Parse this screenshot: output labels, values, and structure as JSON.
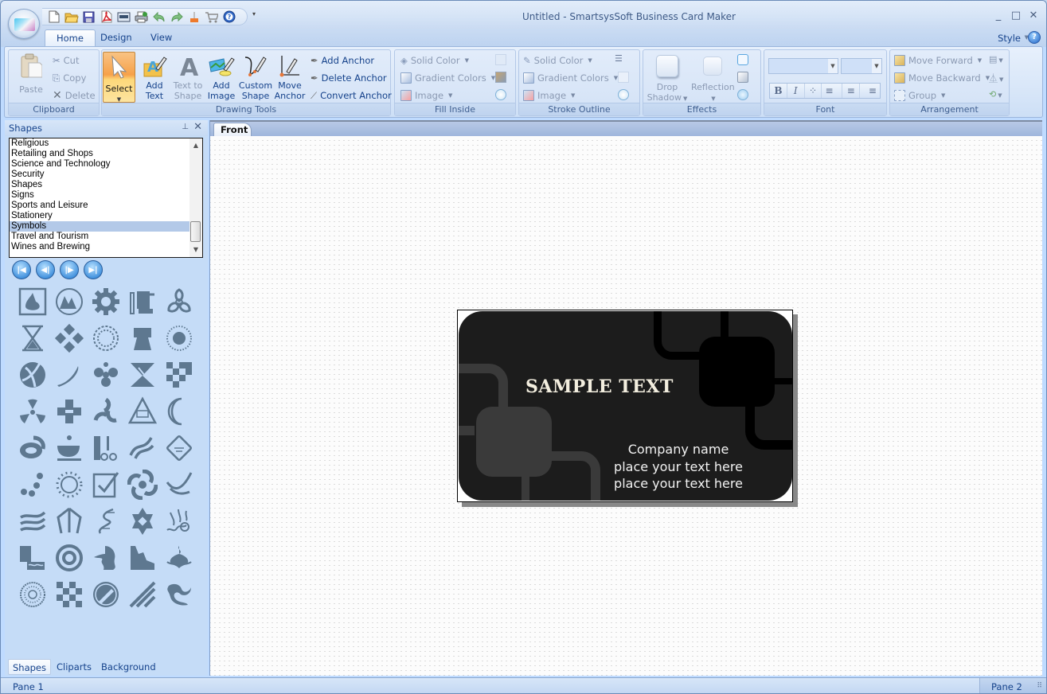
{
  "window": {
    "title": "Untitled - SmartsysSoft Business Card Maker",
    "controls": {
      "minimize": "_",
      "maximize": "□",
      "close": "✕"
    }
  },
  "quick_access": [
    {
      "name": "new-document-icon"
    },
    {
      "name": "open-folder-icon"
    },
    {
      "name": "save-icon"
    },
    {
      "name": "export-pdf-icon"
    },
    {
      "name": "export-image-icon"
    },
    {
      "name": "print-icon"
    },
    {
      "name": "undo-icon"
    },
    {
      "name": "redo-icon"
    },
    {
      "name": "clear-icon"
    },
    {
      "name": "shopping-cart-icon"
    },
    {
      "name": "help-icon"
    }
  ],
  "ribbon_tabs": [
    {
      "label": "Home",
      "active": true
    },
    {
      "label": "Design",
      "active": false
    },
    {
      "label": "View",
      "active": false
    }
  ],
  "style_menu": {
    "label": "Style",
    "help": "?"
  },
  "ribbon": {
    "clipboard": {
      "label": "Clipboard",
      "paste": "Paste",
      "cut": "Cut",
      "copy": "Copy",
      "delete": "Delete"
    },
    "drawing_tools": {
      "label": "Drawing Tools",
      "select": "Select",
      "add_text": "Add\nText",
      "add_text_l1": "Add",
      "add_text_l2": "Text",
      "text_to_shape_l1": "Text to",
      "text_to_shape_l2": "Shape",
      "add_image_l1": "Add",
      "add_image_l2": "Image",
      "custom_shape_l1": "Custom",
      "custom_shape_l2": "Shape",
      "move_anchor_l1": "Move",
      "move_anchor_l2": "Anchor",
      "add_anchor": "Add Anchor",
      "delete_anchor": "Delete Anchor",
      "convert_anchor": "Convert Anchor"
    },
    "fill_inside": {
      "label": "Fill Inside",
      "solid_color": "Solid Color",
      "gradient_colors": "Gradient Colors",
      "image": "Image"
    },
    "stroke_outline": {
      "label": "Stroke Outline",
      "solid_color": "Solid Color",
      "gradient_colors": "Gradient Colors",
      "image": "Image"
    },
    "effects": {
      "label": "Effects",
      "drop_shadow_l1": "Drop",
      "drop_shadow_l2": "Shadow",
      "reflection": "Reflection"
    },
    "font": {
      "label": "Font",
      "family_value": "",
      "size_value": "",
      "bold": "B",
      "italic": "I",
      "outline": "⁘",
      "align_left": "≡",
      "align_center": "≡",
      "align_right": "≡"
    },
    "arrangement": {
      "label": "Arrangement",
      "move_forward": "Move Forward",
      "move_backward": "Move Backward",
      "group": "Group"
    }
  },
  "shapes_panel": {
    "title": "Shapes",
    "categories": [
      {
        "label": "Religious",
        "selected": false
      },
      {
        "label": "Retailing and Shops",
        "selected": false
      },
      {
        "label": "Science and Technology",
        "selected": false
      },
      {
        "label": "Security",
        "selected": false
      },
      {
        "label": "Shapes",
        "selected": false
      },
      {
        "label": "Signs",
        "selected": false
      },
      {
        "label": "Sports and Leisure",
        "selected": false
      },
      {
        "label": "Stationery",
        "selected": false
      },
      {
        "label": "Symbols",
        "selected": true
      },
      {
        "label": "Travel and Tourism",
        "selected": false
      },
      {
        "label": "Wines and Brewing",
        "selected": false
      }
    ],
    "nav_buttons": [
      {
        "name": "first-page-button",
        "glyph": "|◀"
      },
      {
        "name": "previous-page-button",
        "glyph": "◀|"
      },
      {
        "name": "next-page-button",
        "glyph": "|▶"
      },
      {
        "name": "last-page-button",
        "glyph": "▶|"
      }
    ],
    "symbols": [
      "framed-pear-symbol",
      "mountain-circle-symbol",
      "gear-symbol",
      "machine-symbol",
      "biohazard-symbol",
      "hourglass-symbol",
      "four-diamonds-symbol",
      "dotted-ring-symbol",
      "fist-tower-symbol",
      "sunburst-symbol",
      "swoosh-ball-symbol",
      "sword-symbol",
      "propeller-symbol",
      "hourglass-triangle-symbol",
      "checker-symbol",
      "radiation-symbol",
      "cross-blocks-symbol",
      "triskele-symbol",
      "triangle-emblem-symbol",
      "crescent-symbol",
      "ring-swirl-symbol",
      "teacup-symbol",
      "comb-scissors-symbol",
      "wave-flourish-symbol",
      "book-diamond-symbol",
      "bubbles-symbol",
      "sun-symbol",
      "checkbox-symbol",
      "vortex-symbol",
      "check-swoosh-symbol",
      "wind-waves-symbol",
      "arrow-arch-symbol",
      "wave-lines-symbol",
      "aztec-star-symbol",
      "tribal-face-symbol",
      "pottery-symbol",
      "target-symbol",
      "face-profile-symbol",
      "silhouette-symbol",
      "bulb-swirl-symbol",
      "mandala-symbol",
      "checkerboard-symbol",
      "rocket-circle-symbol",
      "diagonal-stripes-symbol",
      "dragon-symbol"
    ],
    "bottom_tabs": [
      {
        "label": "Shapes",
        "active": true
      },
      {
        "label": "Cliparts",
        "active": false
      },
      {
        "label": "Background",
        "active": false
      }
    ]
  },
  "document": {
    "tabs": [
      {
        "label": "Front",
        "active": true
      }
    ],
    "card": {
      "headline": "SAMPLE TEXT",
      "lines": [
        "Company name",
        "place your text here",
        "place your text here"
      ],
      "background_color": "#1c1c1c",
      "accent_dark": "#000000",
      "accent_gray": "#3a3a3a"
    }
  },
  "status_bar": {
    "pane1": "Pane 1",
    "pane2": "Pane 2"
  }
}
